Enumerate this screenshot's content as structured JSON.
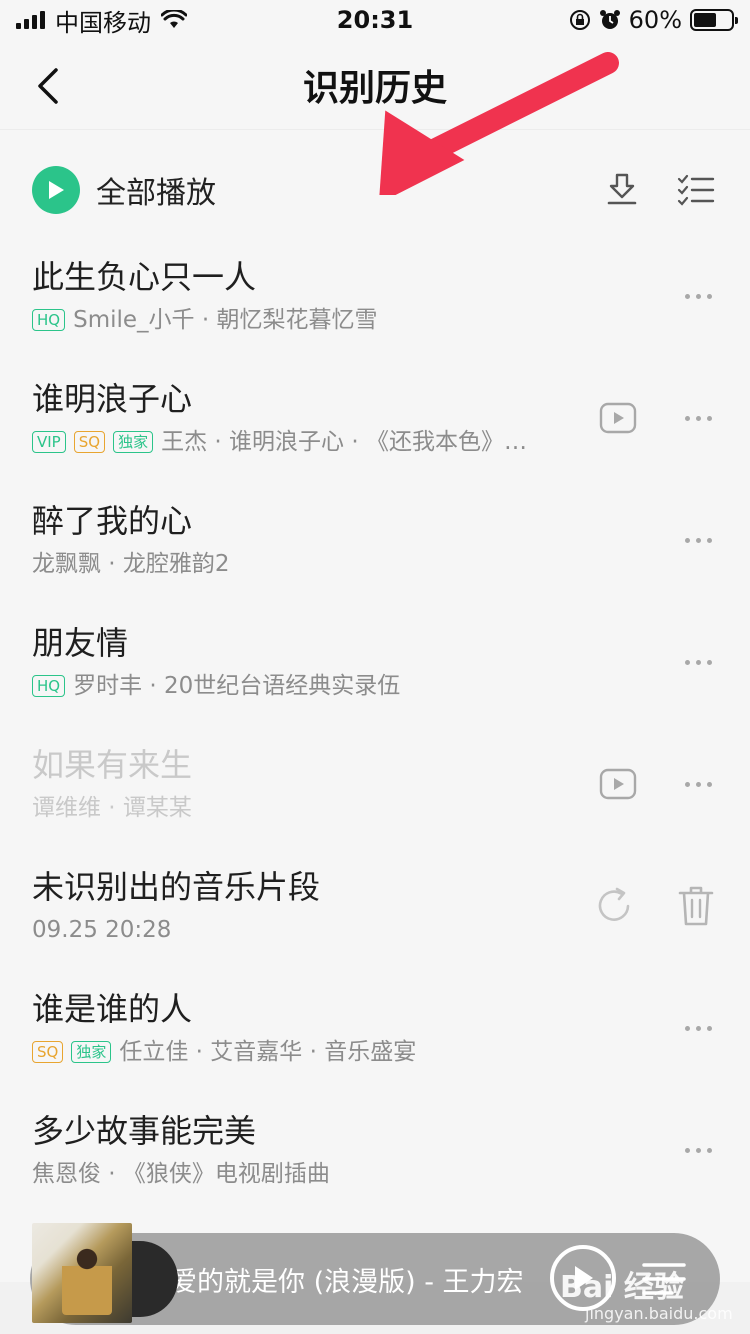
{
  "status_bar": {
    "carrier": "中国移动",
    "time": "20:31",
    "battery": "60%",
    "battery_level": 0.6
  },
  "nav": {
    "title": "识别历史"
  },
  "toolbar": {
    "play_all_label": "全部播放"
  },
  "songs": [
    {
      "title": "此生负心只一人",
      "badges": [
        "HQ"
      ],
      "meta": "Smile_小千 · 朝忆梨花暮忆雪",
      "has_mv": false,
      "disabled": false
    },
    {
      "title": "谁明浪子心",
      "badges": [
        "VIP",
        "SQ",
        "独家"
      ],
      "meta": "王杰 · 谁明浪子心 · 《还我本色》…",
      "has_mv": true,
      "disabled": false
    },
    {
      "title": "醉了我的心",
      "badges": [],
      "meta": "龙飘飘 · 龙腔雅韵2",
      "has_mv": false,
      "disabled": false
    },
    {
      "title": "朋友情",
      "badges": [
        "HQ"
      ],
      "meta": "罗时丰 · 20世纪台语经典实录伍",
      "has_mv": false,
      "disabled": false
    },
    {
      "title": "如果有来生",
      "badges": [],
      "meta": "谭维维 · 谭某某",
      "has_mv": true,
      "disabled": true
    },
    {
      "title": "未识别出的音乐片段",
      "badges": [],
      "meta": "09.25 20:28",
      "has_mv": false,
      "disabled": false,
      "unrecognized": true
    },
    {
      "title": "谁是谁的人",
      "badges": [
        "SQ",
        "独家"
      ],
      "meta": "任立佳 · 艾音嘉华 · 音乐盛宴",
      "has_mv": false,
      "disabled": false
    },
    {
      "title": "多少故事能完美",
      "badges": [],
      "meta": "焦恩俊 · 《狼侠》电视剧插曲",
      "has_mv": false,
      "disabled": false
    }
  ],
  "player": {
    "now_playing": "爱的就是你 (浪漫版) - 王力宏"
  },
  "watermark": {
    "brand": "Bai 经验",
    "site": "jingyan.baidu.com"
  },
  "colors": {
    "accent": "#2bc48a",
    "sq": "#e8a530",
    "arrow": "#f0334f"
  }
}
